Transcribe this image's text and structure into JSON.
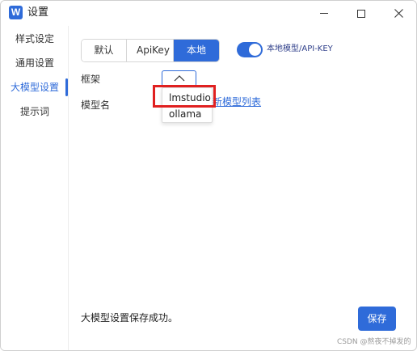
{
  "window": {
    "title": "设置",
    "app_icon_letter": "W"
  },
  "colors": {
    "accent": "#2f6bd9",
    "highlight_box": "#e02020"
  },
  "sidebar": {
    "items": [
      {
        "label": "样式设定",
        "active": false
      },
      {
        "label": "通用设置",
        "active": false
      },
      {
        "label": "大模型设置",
        "active": true
      },
      {
        "label": "提示词",
        "active": false
      }
    ]
  },
  "mode_tabs": {
    "options": [
      "默认",
      "ApiKey",
      "本地"
    ],
    "selected": "本地"
  },
  "toggle": {
    "label": "本地模型/API-KEY",
    "on": true
  },
  "form": {
    "framework_label": "框架",
    "model_name_label": "模型名",
    "refresh_link": "新模型列表"
  },
  "dropdown": {
    "options": [
      "lmstudio",
      "ollama"
    ],
    "highlighted": "lmstudio"
  },
  "status": {
    "message": "大模型设置保存成功。"
  },
  "buttons": {
    "save": "保存"
  },
  "watermark": "CSDN @熬夜不掉发的"
}
